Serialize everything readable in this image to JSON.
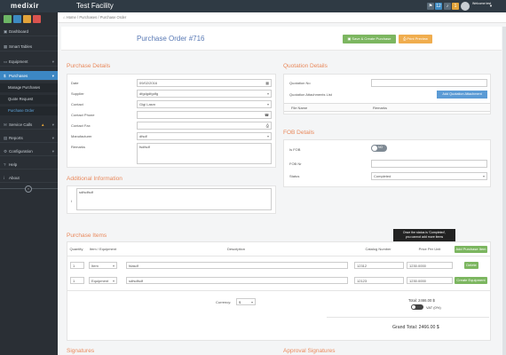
{
  "app": {
    "logo": "medixir",
    "facility": "Test Facility",
    "user_label": "Welcome test"
  },
  "topbar": {
    "badges": [
      "12",
      "1",
      "3"
    ]
  },
  "breadcrumb": {
    "home": "Home",
    "sep": "/",
    "parent": "Purchases",
    "current": "Purchase Order"
  },
  "sidebar": {
    "items": [
      {
        "icon": "▣",
        "label": "Dashboard"
      },
      {
        "icon": "▦",
        "label": "Smart Tables"
      },
      {
        "icon": "▭",
        "label": "Equipment"
      },
      {
        "icon": "$",
        "label": "Purchases"
      },
      {
        "icon": "✉",
        "label": "Service Calls"
      },
      {
        "icon": "▤",
        "label": "Reports"
      },
      {
        "icon": "⚙",
        "label": "Configuration"
      },
      {
        "icon": "?",
        "label": "Help"
      },
      {
        "icon": "i",
        "label": "About"
      }
    ],
    "sub_items": [
      "Manage Purchases",
      "Quote Request",
      "Purchase Order"
    ]
  },
  "po": {
    "title": "Purchase Order #716",
    "save_label": "Save & Create Purchase",
    "print_label": "Print Preview"
  },
  "purchase_details": {
    "title": "Purchase Details",
    "date_label": "Date",
    "date": "09/02/2016",
    "supplier_label": "Supplier",
    "supplier": "dfgdgdfgdfg",
    "contact_label": "Contact",
    "contact": "Gigi Lasrn",
    "phone_label": "Contact Phone",
    "phone": "",
    "fax_label": "Contact Fax",
    "fax": "",
    "manufacturer_label": "Manufacturer",
    "manufacturer": "dfsdf",
    "remarks_label": "Remarks",
    "remarks": "fsdfsdf"
  },
  "quotation": {
    "title": "Quotation Details",
    "no_label": "Quotation No",
    "no": "",
    "attach_label": "Quotation Attachments List",
    "add_attach_label": "Add Quotation Attachment",
    "col_file": "File Name",
    "col_remarks": "Remarks"
  },
  "fob": {
    "title": "FOB Details",
    "is_fob_label": "Is FOB",
    "is_fob": "NO",
    "fob_no_label": "FOB Nr",
    "fob_no": "",
    "status_label": "Status",
    "status": "Completed"
  },
  "additional": {
    "title": "Additional Information",
    "text": "sdfsdfsdf"
  },
  "tooltip": {
    "line1": "Once the status is 'Completed',",
    "line2": "you cannot add more items"
  },
  "items": {
    "title": "Purchase Items",
    "headers": [
      "Quantity",
      "Item / Equipment",
      "Description",
      "Catalog Number",
      "Price Per Unit"
    ],
    "add_label": "Add Purchase Item",
    "rows": [
      {
        "qty": "1",
        "type": "Item",
        "desc": "fdasdf",
        "catalog": "12312",
        "price": "1230.0000",
        "action": "Delete"
      },
      {
        "qty": "1",
        "type": "Equipment",
        "desc": "sdfsdfsdf",
        "catalog": "12123",
        "price": "1230.0000",
        "action": "Create Equipment"
      }
    ],
    "currency_label": "Currency:",
    "currency": "$",
    "total_label": "Total: 2466.00 $",
    "vat_label": "VAT (0%)",
    "grand_total_label": "Grand Total: 2466.00 $"
  },
  "footer": {
    "signatures": "Signatures",
    "approval": "Approval Signatures"
  },
  "colors": {
    "accent": "#e9895c",
    "title": "#5a7ab5",
    "sidebar": "#2a2f35",
    "green": "#7cb660",
    "blue": "#5b9bd5"
  }
}
